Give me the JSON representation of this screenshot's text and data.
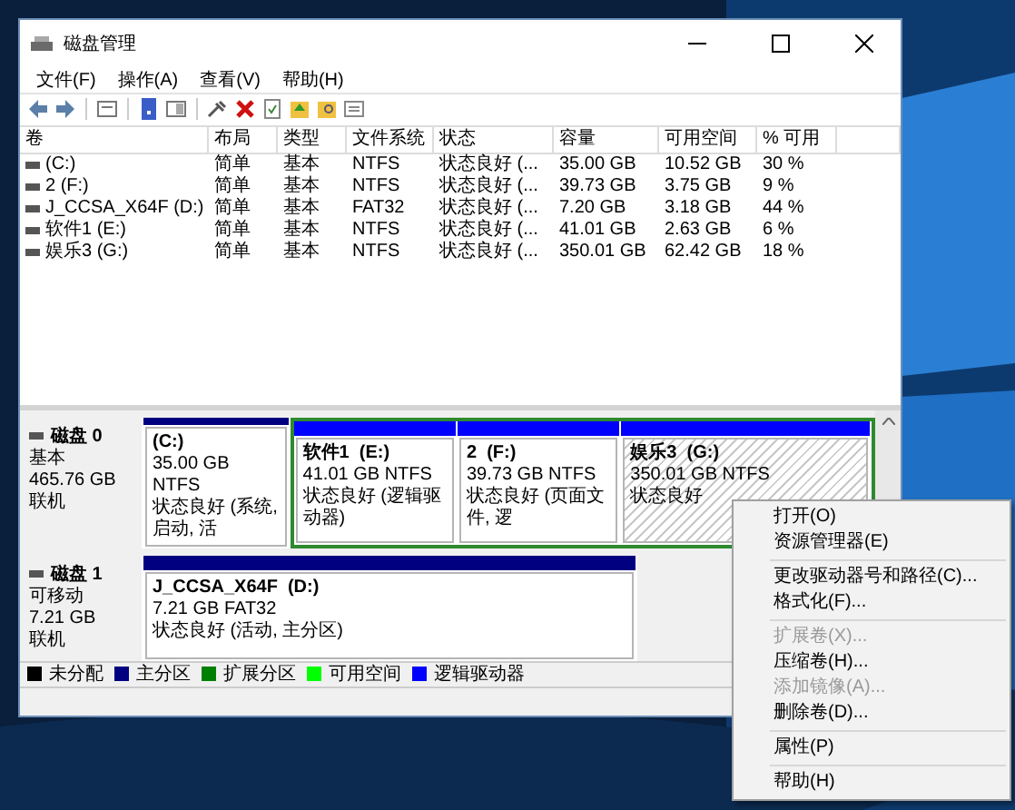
{
  "window": {
    "title": "磁盘管理"
  },
  "menu": [
    "文件(F)",
    "操作(A)",
    "查看(V)",
    "帮助(H)"
  ],
  "table": {
    "columns": [
      "卷",
      "布局",
      "类型",
      "文件系统",
      "状态",
      "容量",
      "可用空间",
      "% 可用"
    ],
    "rows": [
      {
        "cells": [
          "(C:)",
          "简单",
          "基本",
          "NTFS",
          "状态良好 (...",
          "35.00 GB",
          "10.52 GB",
          "30 %"
        ]
      },
      {
        "cells": [
          "2 (F:)",
          "简单",
          "基本",
          "NTFS",
          "状态良好 (...",
          "39.73 GB",
          "3.75 GB",
          "9 %"
        ]
      },
      {
        "cells": [
          "J_CCSA_X64F (D:)",
          "简单",
          "基本",
          "FAT32",
          "状态良好 (...",
          "7.20 GB",
          "3.18 GB",
          "44 %"
        ]
      },
      {
        "cells": [
          "软件1 (E:)",
          "简单",
          "基本",
          "NTFS",
          "状态良好 (...",
          "41.01 GB",
          "2.63 GB",
          "6 %"
        ]
      },
      {
        "cells": [
          "娱乐3 (G:)",
          "简单",
          "基本",
          "NTFS",
          "状态良好 (...",
          "350.01 GB",
          "62.42 GB",
          "18 %"
        ]
      }
    ]
  },
  "disks": [
    {
      "name": "磁盘 0",
      "type": "基本",
      "size": "465.76 GB",
      "state": "联机",
      "partitions": [
        {
          "label": "(C:)",
          "size": "35.00 GB NTFS",
          "status": "状态良好 (系统, 启动, 活",
          "kind": "primary",
          "selected": false
        },
        {
          "label": "软件1  (E:)",
          "size": "41.01 GB NTFS",
          "status": "状态良好 (逻辑驱动器)",
          "kind": "logical",
          "selected": false
        },
        {
          "label": "2  (F:)",
          "size": "39.73 GB NTFS",
          "status": "状态良好 (页面文件, 逻",
          "kind": "logical",
          "selected": false
        },
        {
          "label": "娱乐3  (G:)",
          "size": "350.01 GB NTFS",
          "status": "状态良好",
          "kind": "logical",
          "selected": true
        }
      ]
    },
    {
      "name": "磁盘 1",
      "type": "可移动",
      "size": "7.21 GB",
      "state": "联机",
      "partitions": [
        {
          "label": "J_CCSA_X64F  (D:)",
          "size": "7.21 GB FAT32",
          "status": "状态良好 (活动, 主分区)",
          "kind": "primary",
          "selected": false
        }
      ]
    }
  ],
  "legend": [
    {
      "label": "未分配",
      "color": "#000000"
    },
    {
      "label": "主分区",
      "color": "#000080"
    },
    {
      "label": "扩展分区",
      "color": "#008000"
    },
    {
      "label": "可用空间",
      "color": "#00ff00"
    },
    {
      "label": "逻辑驱动器",
      "color": "#0000ff"
    }
  ],
  "context_menu": [
    {
      "kind": "item",
      "label": "打开(O)",
      "disabled": false
    },
    {
      "kind": "item",
      "label": "资源管理器(E)",
      "disabled": false
    },
    {
      "kind": "separator"
    },
    {
      "kind": "item",
      "label": "更改驱动器号和路径(C)...",
      "disabled": false
    },
    {
      "kind": "item",
      "label": "格式化(F)...",
      "disabled": false
    },
    {
      "kind": "separator"
    },
    {
      "kind": "item",
      "label": "扩展卷(X)...",
      "disabled": true
    },
    {
      "kind": "item",
      "label": "压缩卷(H)...",
      "disabled": false
    },
    {
      "kind": "item",
      "label": "添加镜像(A)...",
      "disabled": true
    },
    {
      "kind": "item",
      "label": "删除卷(D)...",
      "disabled": false
    },
    {
      "kind": "separator"
    },
    {
      "kind": "item",
      "label": "属性(P)",
      "disabled": false
    },
    {
      "kind": "separator"
    },
    {
      "kind": "item",
      "label": "帮助(H)",
      "disabled": false
    }
  ]
}
